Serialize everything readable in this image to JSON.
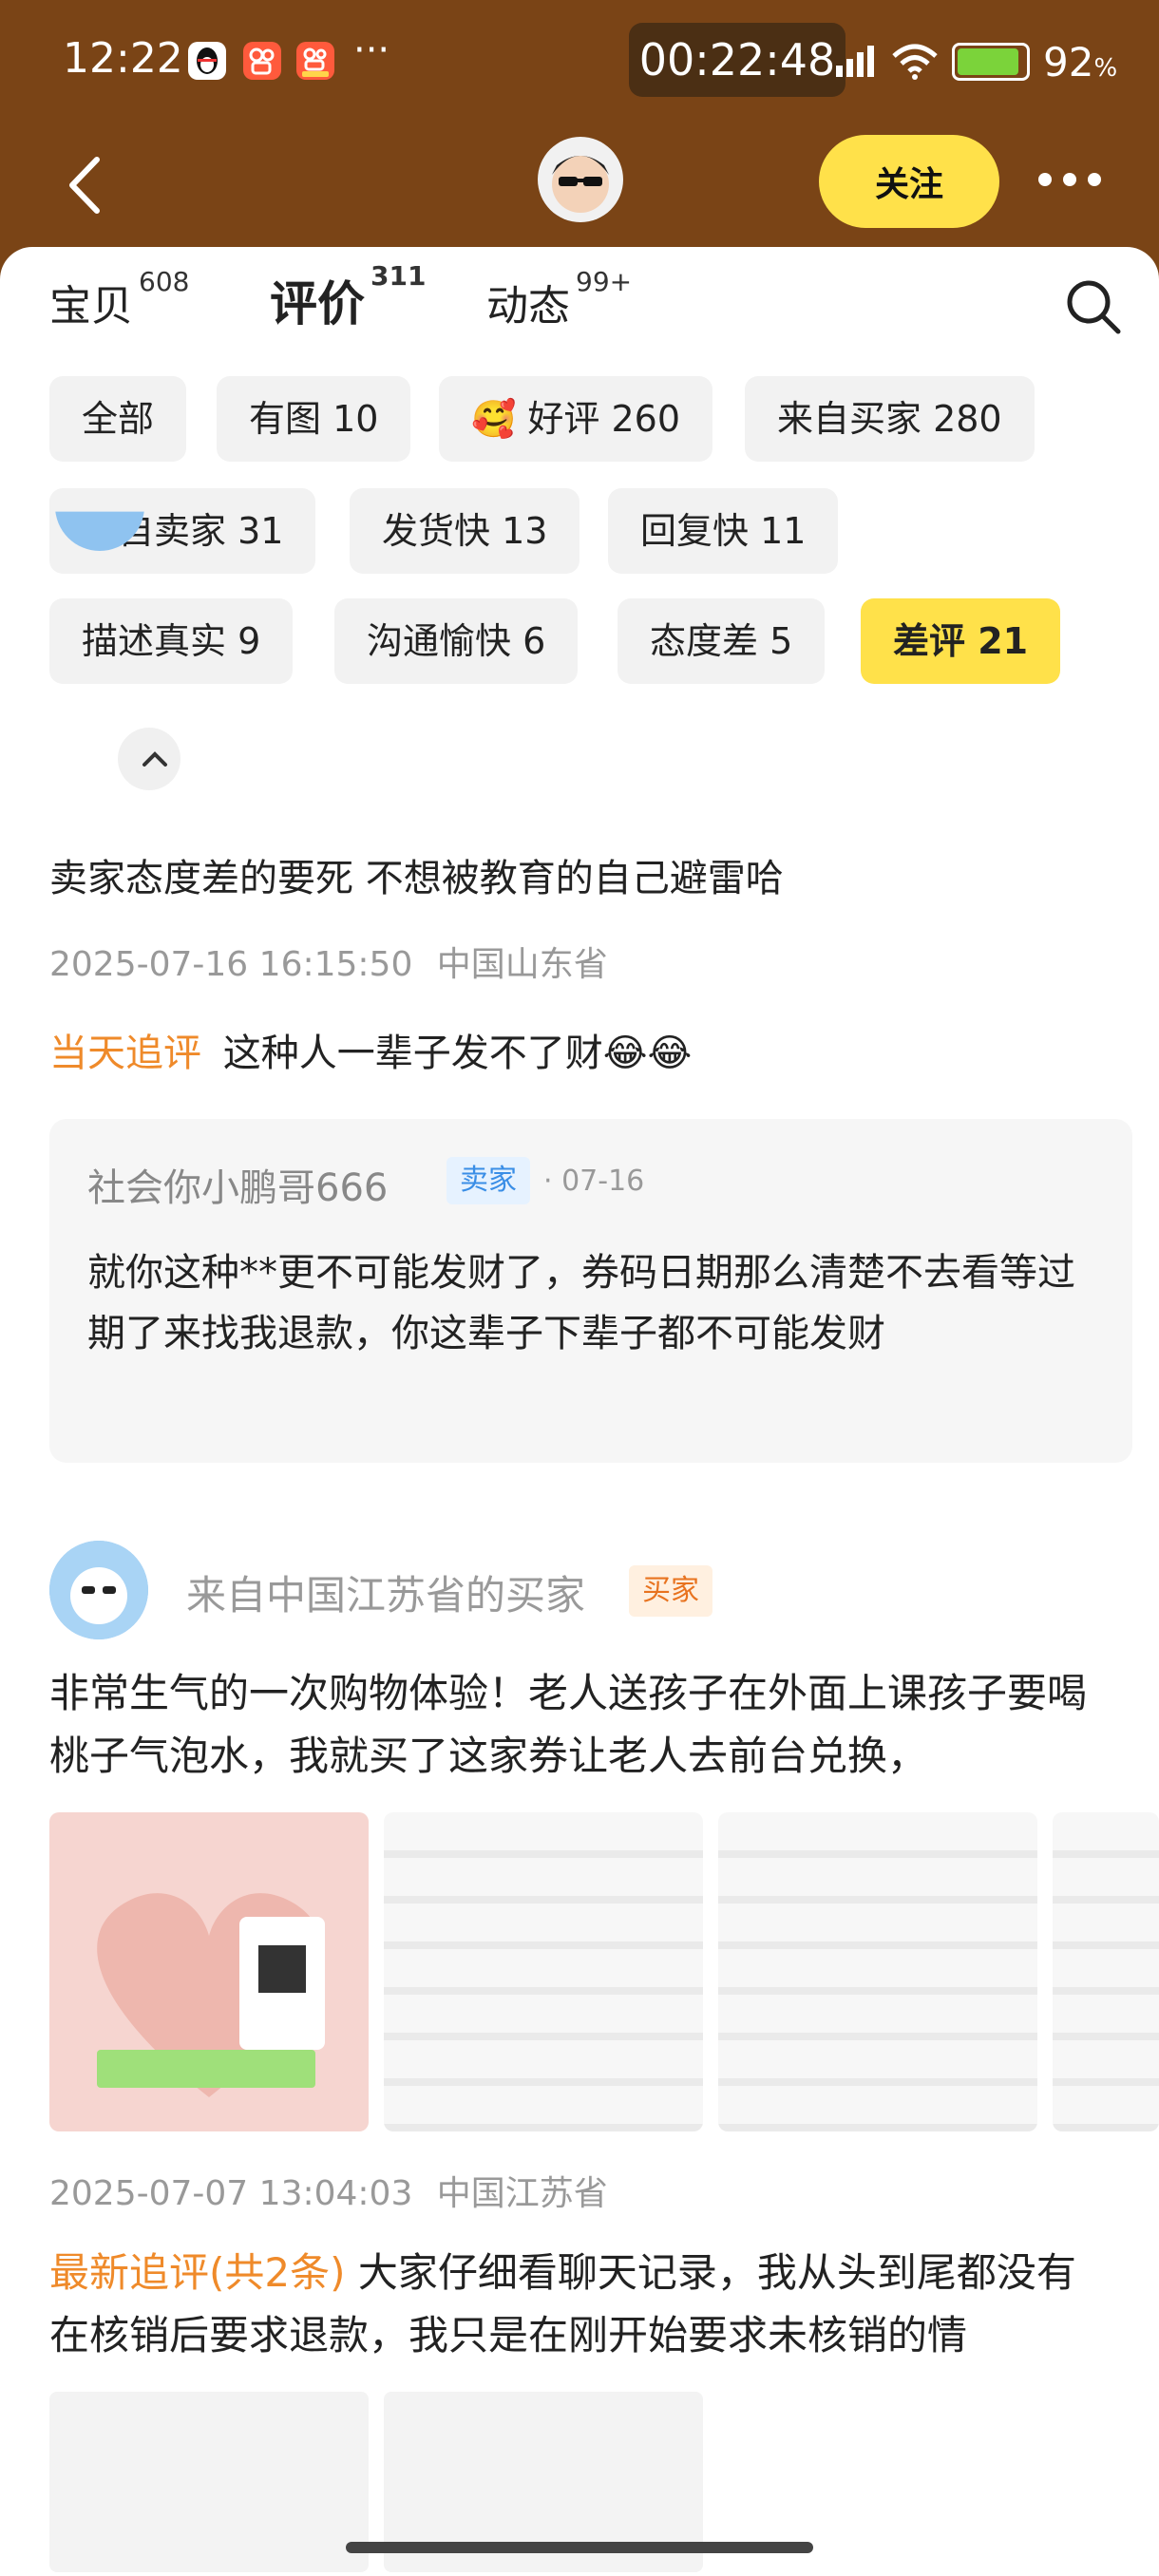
{
  "status": {
    "time": "12:22",
    "dots": "···",
    "timer": "00:22:48",
    "battery_percent": "92",
    "battery_symbol": "%",
    "battery_level": 0.92
  },
  "nav": {
    "follow_label": "关注"
  },
  "tabs": [
    {
      "label": "宝贝",
      "count": "608"
    },
    {
      "label": "评价",
      "count": "311"
    },
    {
      "label": "动态",
      "count": "99+"
    }
  ],
  "filters": [
    {
      "label": "全部"
    },
    {
      "label": "有图 10"
    },
    {
      "emoji": "🥰",
      "label": "好评 260"
    },
    {
      "label": "来自买家 280"
    },
    {
      "label": "来自卖家 31"
    },
    {
      "label": "发货快 13"
    },
    {
      "label": "回复快 11"
    },
    {
      "label": "描述真实 9"
    },
    {
      "label": "沟通愉快 6"
    },
    {
      "label": "态度差 5"
    },
    {
      "label": "差评 21"
    }
  ],
  "review1": {
    "text": "卖家态度差的要死 不想被教育的自己避雷哈",
    "date": "2025-07-16 16:15:50",
    "location": "中国山东省",
    "followup_label": "当天追评",
    "followup_text": "这种人一辈子发不了财😂😂",
    "reply": {
      "name": "社会你小鹏哥666",
      "tag": "卖家",
      "date": "· 07-16",
      "body": "就你这种**更不可能发财了，券码日期那么清楚不去看等过期了来找我退款，你这辈子下辈子都不可能发财"
    }
  },
  "review2": {
    "buyer_name": "来自中国江苏省的买家",
    "buyer_tag": "买家",
    "text": "非常生气的一次购物体验！老人送孩子在外面上课孩子要喝桃子气泡水，我就买了这家券让老人去前台兑换，",
    "date": "2025-07-07 13:04:03",
    "location": "中国江苏省",
    "followup_label": "最新追评(共2条)",
    "followup_text": "大家仔细看聊天记录，我从头到尾都没有在核销后要求退款，我只是在刚开始要求未核销的情"
  }
}
